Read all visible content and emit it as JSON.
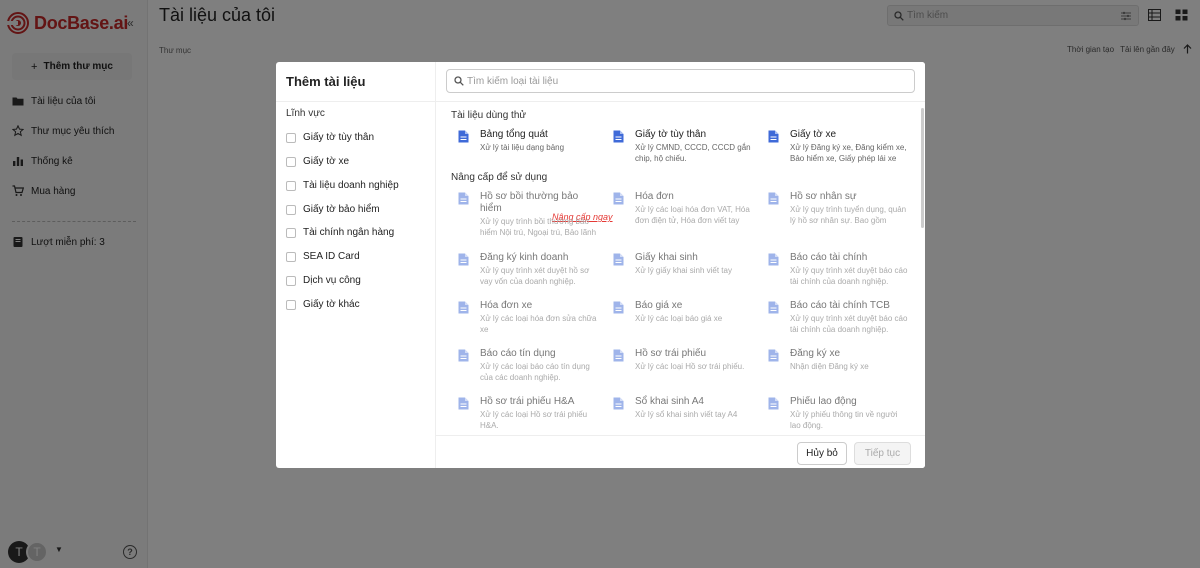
{
  "app": {
    "brand": "DocBase.ai",
    "brand_color": "#c62828"
  },
  "sidebar": {
    "add_folder": "Thêm thư mục",
    "items": [
      {
        "label": "Tài liệu của tôi",
        "icon": "folder-icon"
      },
      {
        "label": "Thư mục yêu thích",
        "icon": "star-icon"
      },
      {
        "label": "Thống kê",
        "icon": "bar-chart-icon"
      },
      {
        "label": "Mua hàng",
        "icon": "cart-icon"
      }
    ],
    "free_credits": "Lượt miễn phí: 3",
    "avatar_primary": "T",
    "avatar_secondary": "T"
  },
  "header": {
    "title": "Tài liệu của tôi",
    "search_placeholder": "Tìm kiếm"
  },
  "main": {
    "folder_label": "Thư mục",
    "sort_field": "Thời gian tạo",
    "sort_option": "Tải lên gần đây"
  },
  "modal": {
    "title": "Thêm tài liệu",
    "field_label": "Lĩnh vực",
    "categories": [
      "Giấy tờ tùy thân",
      "Giấy tờ xe",
      "Tài liệu doanh nghiệp",
      "Giấy tờ bảo hiểm",
      "Tài chính ngân hàng",
      "SEA ID Card",
      "Dịch vụ công",
      "Giấy tờ khác"
    ],
    "type_search_placeholder": "Tìm kiếm loại tài liệu",
    "trial_section": "Tài liệu dùng thử",
    "upgrade_section": "Nâng cấp để sử dụng",
    "upgrade_link": "Nâng cấp ngay",
    "trial_docs": [
      {
        "title": "Bảng tổng quát",
        "desc": "Xử lý tài liệu dạng bảng"
      },
      {
        "title": "Giấy tờ tùy thân",
        "desc": "Xử lý CMND, CCCD, CCCD gắn chip, hộ chiếu."
      },
      {
        "title": "Giấy tờ xe",
        "desc": "Xử lý Đăng ký xe, Đăng kiểm xe, Bảo hiểm xe, Giấy phép lái xe"
      }
    ],
    "upgrade_docs": [
      {
        "title": "Hồ sơ bồi thường bảo hiểm",
        "desc": "Xử lý quy trình bồi thường bảo hiểm Nội trú, Ngoại trú, Bảo lãnh"
      },
      {
        "title": "Hóa đơn",
        "desc": "Xử lý các loại hóa đơn VAT, Hóa đơn điện tử, Hóa đơn viết tay"
      },
      {
        "title": "Hồ sơ nhân sự",
        "desc": "Xử lý quy trình tuyển dụng, quản lý hồ sơ nhân sự. Bao gồm"
      },
      {
        "title": "Đăng ký kinh doanh",
        "desc": "Xử lý quy trình xét duyệt hồ sơ vay vốn của doanh nghiệp."
      },
      {
        "title": "Giấy khai sinh",
        "desc": "Xử lý giấy khai sinh viết tay"
      },
      {
        "title": "Báo cáo tài chính",
        "desc": "Xử lý quy trình xét duyệt báo cáo tài chính của doanh nghiệp."
      },
      {
        "title": "Hóa đơn xe",
        "desc": "Xử lý các loại hóa đơn sửa chữa xe"
      },
      {
        "title": "Báo giá xe",
        "desc": "Xử lý các loại báo giá xe"
      },
      {
        "title": "Báo cáo tài chính TCB",
        "desc": "Xử lý quy trình xét duyệt báo cáo tài chính của doanh nghiệp."
      },
      {
        "title": "Báo cáo tín dụng",
        "desc": "Xử lý các loại báo cáo tín dụng của các doanh nghiệp."
      },
      {
        "title": "Hồ sơ trái phiếu",
        "desc": "Xử lý các loại Hồ sơ trái phiếu."
      },
      {
        "title": "Đăng ký xe",
        "desc": "Nhận diện Đăng ký xe"
      },
      {
        "title": "Hồ sơ trái phiếu H&A",
        "desc": "Xử lý các loại Hồ sơ trái phiếu H&A."
      },
      {
        "title": "Sổ khai sinh A4",
        "desc": "Xử lý sổ khai sinh viết tay A4"
      },
      {
        "title": "Phiếu lao động",
        "desc": "Xử lý phiếu thông tin về người lao động."
      }
    ],
    "cancel": "Hủy bỏ",
    "continue": "Tiếp tục",
    "doc_icon_color": "#3f6ad8"
  }
}
